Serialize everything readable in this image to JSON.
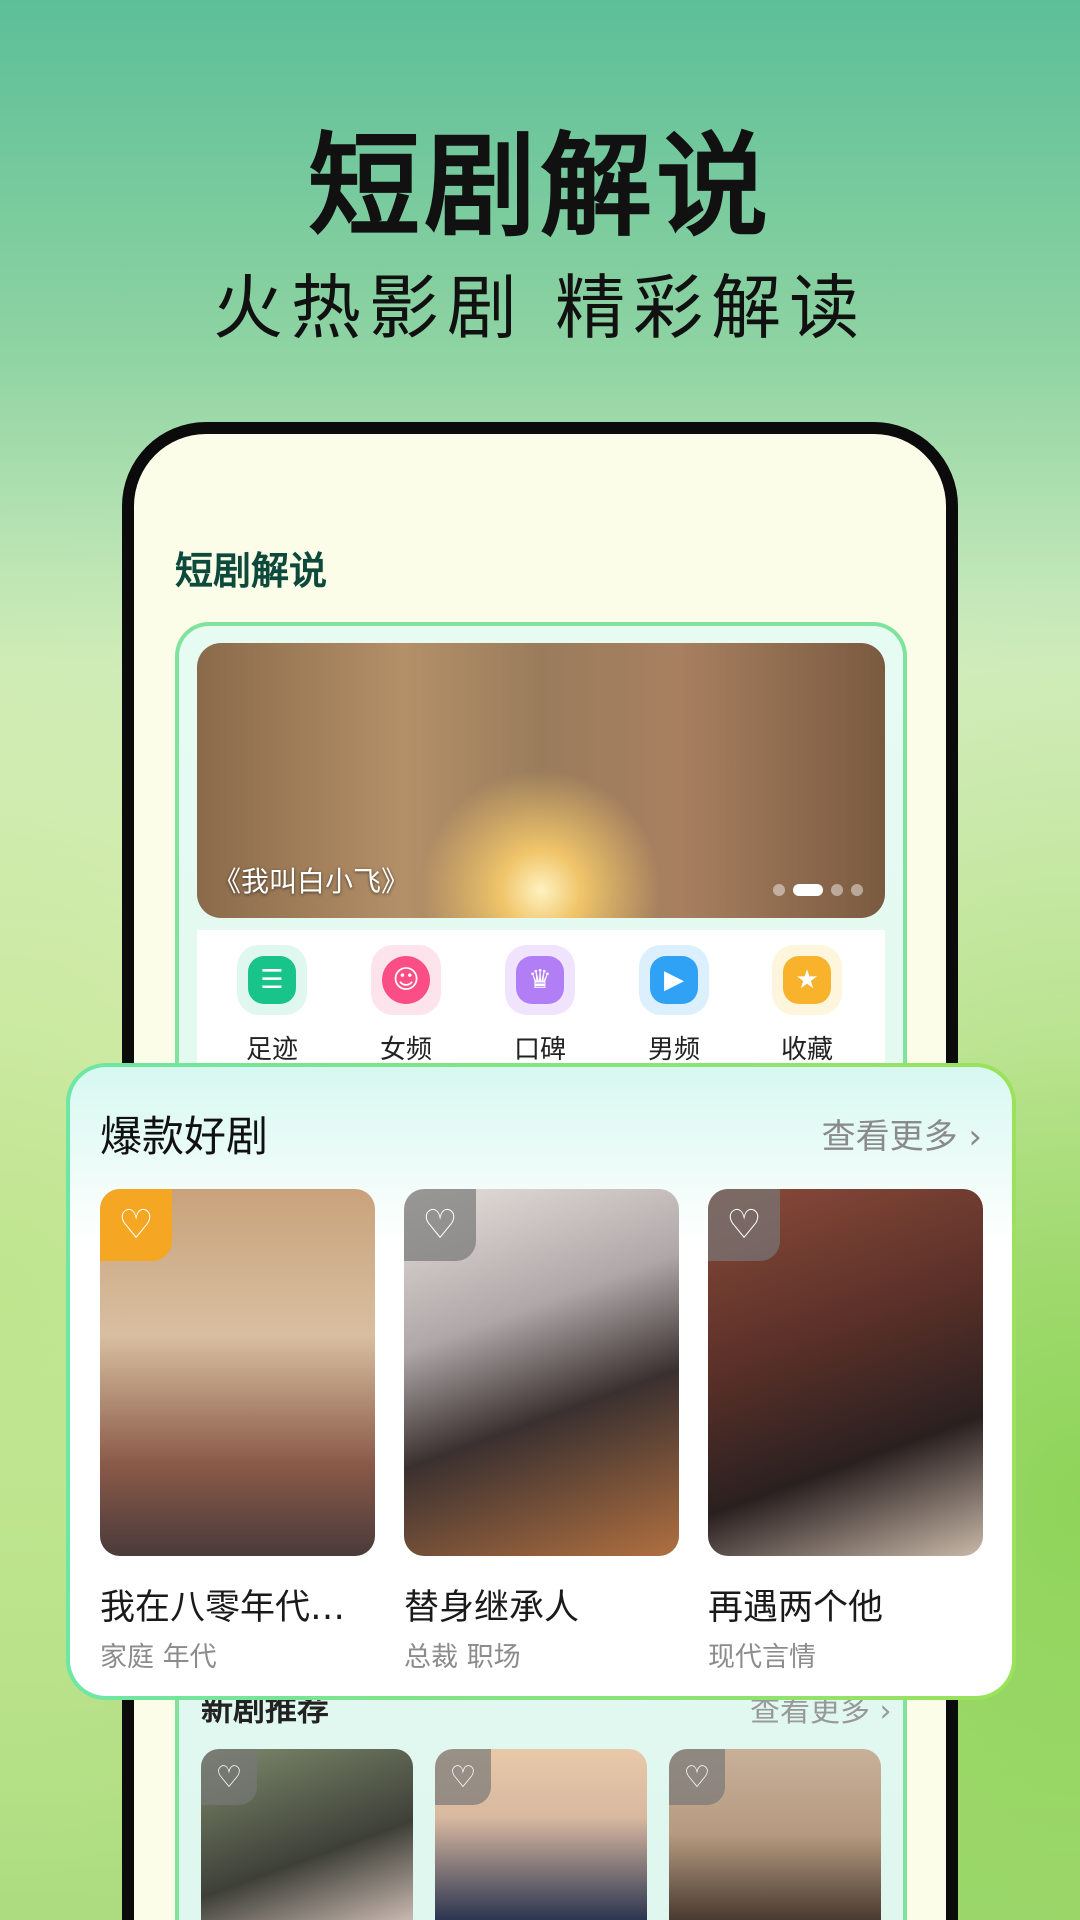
{
  "hero": {
    "title": "短剧解说",
    "subtitle": "火热影剧  精彩解读"
  },
  "app": {
    "title": "短剧解说"
  },
  "banner": {
    "caption": "《我叫白小飞》",
    "slides": 4,
    "active_slide": 2
  },
  "quick_links": [
    {
      "label": "足迹",
      "icon": "list-icon",
      "color": "#19c48a",
      "bg": "#dff7ee"
    },
    {
      "label": "女频",
      "icon": "smile-bubble-icon",
      "color": "#fb4d86",
      "bg": "#fde3ec"
    },
    {
      "label": "口碑",
      "icon": "crown-icon",
      "color": "#b27ef5",
      "bg": "#efe3fd"
    },
    {
      "label": "男频",
      "icon": "play-icon",
      "color": "#2fa2f5",
      "bg": "#dbeffd"
    },
    {
      "label": "收藏",
      "icon": "star-icon",
      "color": "#f8b22c",
      "bg": "#fdf6dd"
    }
  ],
  "hot": {
    "title": "爆款好剧",
    "more": "查看更多 ›",
    "items": [
      {
        "title": "我在八零年代…",
        "tags": "家庭  年代",
        "favorited": true
      },
      {
        "title": "替身继承人",
        "tags": "总裁  职场",
        "favorited": false
      },
      {
        "title": "再遇两个他",
        "tags": "现代言情",
        "favorited": false
      }
    ]
  },
  "new": {
    "title": "新剧推荐",
    "more": "查看更多 ›",
    "count": 3
  }
}
